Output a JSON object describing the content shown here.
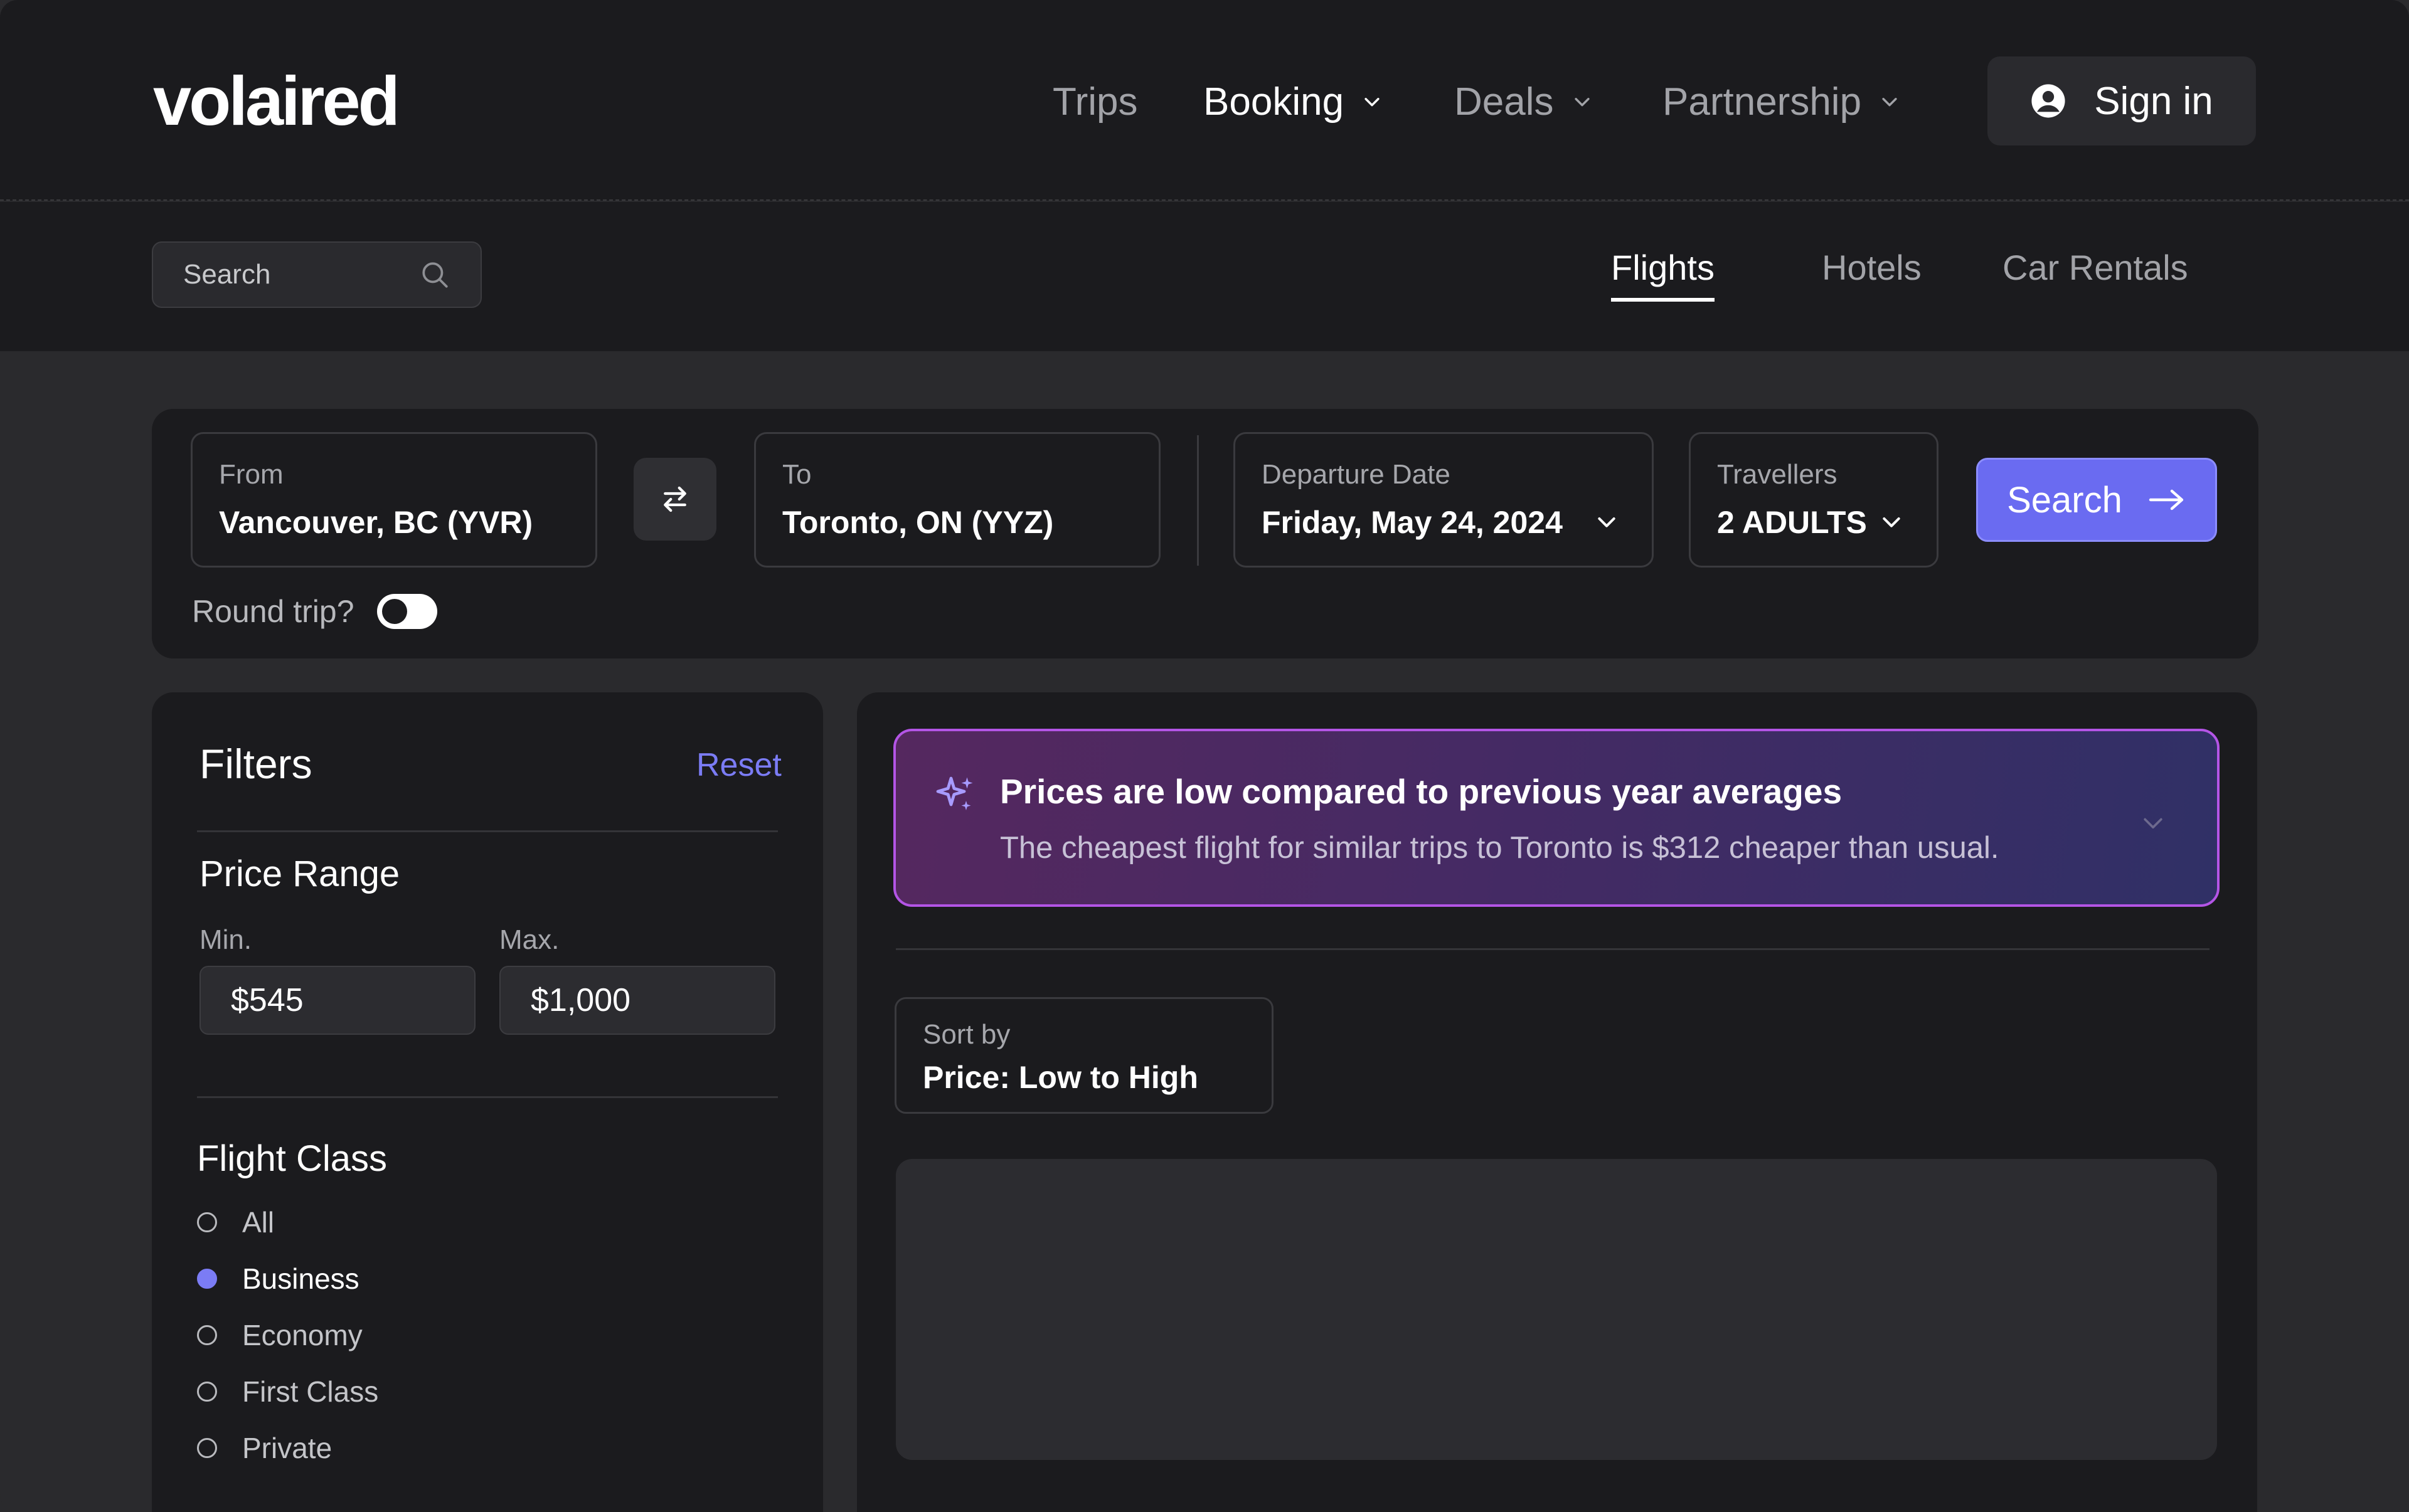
{
  "header": {
    "logo": "volaired",
    "nav": [
      {
        "label": "Trips",
        "has_menu": false
      },
      {
        "label": "Booking",
        "has_menu": true
      },
      {
        "label": "Deals",
        "has_menu": true
      },
      {
        "label": "Partnership",
        "has_menu": true
      }
    ],
    "signin_label": "Sign in"
  },
  "subnav": {
    "search_placeholder": "Search",
    "tabs": [
      {
        "label": "Flights",
        "active": true
      },
      {
        "label": "Hotels",
        "active": false
      },
      {
        "label": "Car Rentals",
        "active": false
      }
    ]
  },
  "search_form": {
    "from_label": "From",
    "from_value": "Vancouver, BC (YVR)",
    "to_label": "To",
    "to_value": "Toronto, ON (YYZ)",
    "date_label": "Departure Date",
    "date_value": "Friday, May 24, 2024",
    "travellers_label": "Travellers",
    "travellers_value": "2 ADULTS",
    "search_label": "Search",
    "round_trip_label": "Round trip?",
    "round_trip_on": false
  },
  "filters": {
    "title": "Filters",
    "reset_label": "Reset",
    "price_range_title": "Price Range",
    "min_label": "Min.",
    "min_value": "$545",
    "max_label": "Max.",
    "max_value": "$1,000",
    "flight_class_title": "Flight Class",
    "flight_classes": [
      {
        "label": "All",
        "selected": false
      },
      {
        "label": "Business",
        "selected": true
      },
      {
        "label": "Economy",
        "selected": false
      },
      {
        "label": "First Class",
        "selected": false
      },
      {
        "label": "Private",
        "selected": false
      }
    ]
  },
  "results": {
    "banner_title": "Prices are low compared to previous year averages",
    "banner_body": "The cheapest flight for similar trips to Toronto is $312 cheaper than usual.",
    "sort_label": "Sort by",
    "sort_value": "Price: Low to High"
  },
  "colors": {
    "background": "#2a2a2d",
    "surface": "#1b1b1e",
    "accent": "#6a6bf1",
    "accent_text": "#7b7cf5",
    "banner_border": "#b455e6"
  }
}
